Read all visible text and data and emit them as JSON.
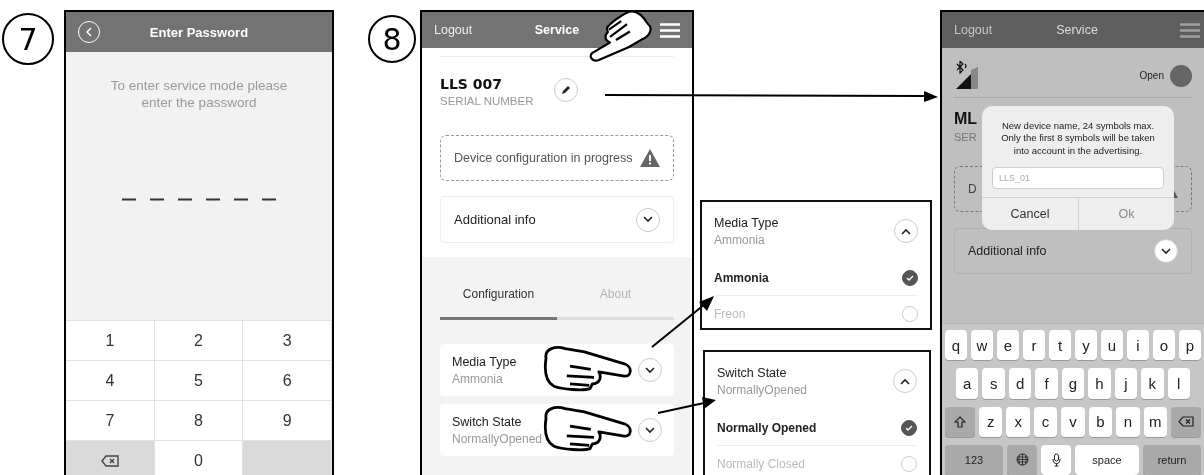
{
  "steps": [
    {
      "number": "7"
    },
    {
      "number": "8"
    }
  ],
  "password_screen": {
    "title": "Enter Password",
    "prompt": "To enter service mode please enter the password",
    "keypad": [
      {
        "kind": "digit",
        "label": "1"
      },
      {
        "kind": "digit",
        "label": "2"
      },
      {
        "kind": "digit",
        "label": "3"
      },
      {
        "kind": "digit",
        "label": "4"
      },
      {
        "kind": "digit",
        "label": "5"
      },
      {
        "kind": "digit",
        "label": "6"
      },
      {
        "kind": "digit",
        "label": "7"
      },
      {
        "kind": "digit",
        "label": "8"
      },
      {
        "kind": "digit",
        "label": "9"
      },
      {
        "kind": "backspace"
      },
      {
        "kind": "digit",
        "label": "0"
      },
      {
        "kind": "blank"
      }
    ]
  },
  "service_screen": {
    "header": {
      "action": "Logout",
      "title": "Service"
    },
    "device": {
      "name": "LLS 007",
      "caption": "SERIAL NUMBER"
    },
    "notice": "Device configuration in progress",
    "info": {
      "label": "Additional info",
      "expanded": false
    },
    "tabs": [
      {
        "label": "Configuration",
        "selected": true
      },
      {
        "label": "About",
        "selected": false
      }
    ],
    "settings": [
      {
        "label": "Media Type",
        "value": "Ammonia",
        "expanded": false
      },
      {
        "label": "Switch State",
        "value": "NormallyOpened",
        "expanded": false
      }
    ]
  },
  "dropdowns": [
    {
      "label": "Media Type",
      "value": "Ammonia",
      "expanded": true,
      "options": [
        {
          "label": "Ammonia",
          "selected": true
        },
        {
          "label": "Freon",
          "selected": false
        }
      ]
    },
    {
      "label": "Switch State",
      "value": "NormallyOpened",
      "expanded": true,
      "options": [
        {
          "label": "Normally Opened",
          "selected": true
        },
        {
          "label": "Normally Closed",
          "selected": false
        }
      ]
    }
  ],
  "rename_screen": {
    "header": {
      "action": "Logout",
      "title": "Service"
    },
    "status": {
      "label": "Open"
    },
    "device": {
      "name": "ML",
      "caption": "SER"
    },
    "notice": "D",
    "dialog": {
      "message": "New device name, 24 symbols max. Only the first 8 symbols will be taken into account in the advertising.",
      "placeholder": "LLS_01",
      "buttons": [
        "Cancel",
        "Ok"
      ]
    },
    "info": {
      "label": "Additional info",
      "expanded": false
    },
    "keyboard": [
      [
        {
          "kind": "char",
          "label": "q"
        },
        {
          "kind": "char",
          "label": "w"
        },
        {
          "kind": "char",
          "label": "e"
        },
        {
          "kind": "char",
          "label": "r"
        },
        {
          "kind": "char",
          "label": "t"
        },
        {
          "kind": "char",
          "label": "y"
        },
        {
          "kind": "char",
          "label": "u"
        },
        {
          "kind": "char",
          "label": "i"
        },
        {
          "kind": "char",
          "label": "o"
        },
        {
          "kind": "char",
          "label": "p"
        }
      ],
      [
        {
          "kind": "char",
          "label": "a"
        },
        {
          "kind": "char",
          "label": "s"
        },
        {
          "kind": "char",
          "label": "d"
        },
        {
          "kind": "char",
          "label": "f"
        },
        {
          "kind": "char",
          "label": "g"
        },
        {
          "kind": "char",
          "label": "h"
        },
        {
          "kind": "char",
          "label": "j"
        },
        {
          "kind": "char",
          "label": "k"
        },
        {
          "kind": "char",
          "label": "l"
        }
      ],
      [
        {
          "kind": "shift"
        },
        {
          "kind": "char",
          "label": "z"
        },
        {
          "kind": "char",
          "label": "x"
        },
        {
          "kind": "char",
          "label": "c"
        },
        {
          "kind": "char",
          "label": "v"
        },
        {
          "kind": "char",
          "label": "b"
        },
        {
          "kind": "char",
          "label": "n"
        },
        {
          "kind": "char",
          "label": "m"
        },
        {
          "kind": "backspace"
        }
      ],
      [
        {
          "kind": "func",
          "label": "123"
        },
        {
          "kind": "globe"
        },
        {
          "kind": "mic"
        },
        {
          "kind": "space",
          "label": "space"
        },
        {
          "kind": "func",
          "label": "return"
        }
      ]
    ]
  }
}
